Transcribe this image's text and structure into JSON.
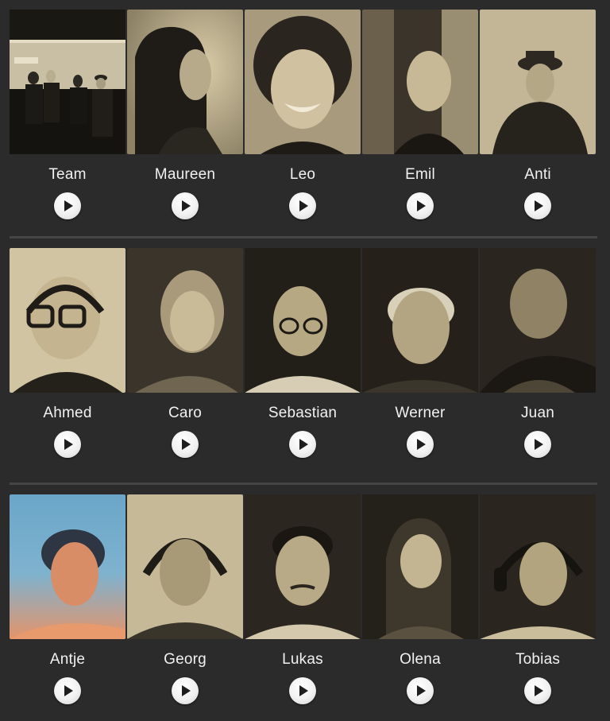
{
  "gallery": {
    "rows": [
      [
        {
          "name": "Team",
          "photo": "group-photo"
        },
        {
          "name": "Maureen",
          "photo": "portrait"
        },
        {
          "name": "Leo",
          "photo": "portrait"
        },
        {
          "name": "Emil",
          "photo": "portrait"
        },
        {
          "name": "Anti",
          "photo": "portrait"
        }
      ],
      [
        {
          "name": "Ahmed",
          "photo": "portrait"
        },
        {
          "name": "Caro",
          "photo": "portrait"
        },
        {
          "name": "Sebastian",
          "photo": "portrait"
        },
        {
          "name": "Werner",
          "photo": "portrait"
        },
        {
          "name": "Juan",
          "photo": "portrait"
        }
      ],
      [
        {
          "name": "Antje",
          "photo": "portrait-colored"
        },
        {
          "name": "Georg",
          "photo": "portrait"
        },
        {
          "name": "Lukas",
          "photo": "portrait"
        },
        {
          "name": "Olena",
          "photo": "portrait"
        },
        {
          "name": "Tobias",
          "photo": "portrait"
        }
      ]
    ],
    "play_icon": "play-icon",
    "colors": {
      "background": "#2b2b2c",
      "divider": "#444547",
      "label": "#f1f1f1",
      "play_button": "#f1f1f1",
      "sepia_light": "#d8c9a3",
      "sepia_dark": "#1d1a15"
    }
  }
}
